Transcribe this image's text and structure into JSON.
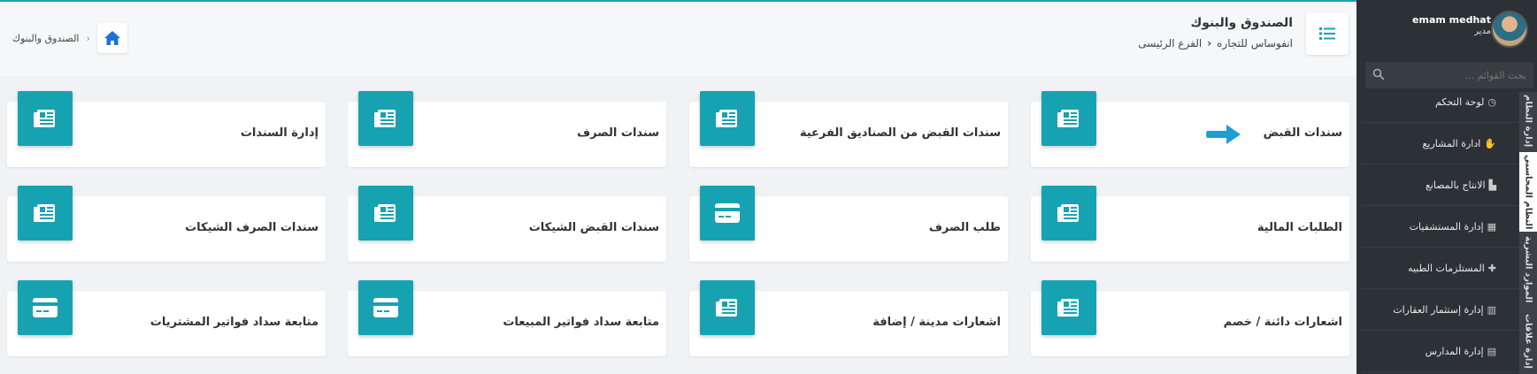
{
  "header": {
    "title": "الصندوق والبنوك",
    "company": "انفوساس للتجاره",
    "branch": "الفرع الرئيسى",
    "breadcrumb": "الصندوق والبنوك"
  },
  "cards": [
    {
      "label": "سندات القبض",
      "icon": "receipt-icon"
    },
    {
      "label": "سندات القبض من الصناديق الفرعية",
      "icon": "receipt-icon"
    },
    {
      "label": "سندات الصرف",
      "icon": "receipt-icon"
    },
    {
      "label": "إدارة السندات",
      "icon": "receipt-icon"
    },
    {
      "label": "الطلبات المالية",
      "icon": "receipt-icon"
    },
    {
      "label": "طلب الصرف",
      "icon": "credit-card-icon"
    },
    {
      "label": "سندات القبض الشيكات",
      "icon": "receipt-icon"
    },
    {
      "label": "سندات الصرف الشيكات",
      "icon": "receipt-icon"
    },
    {
      "label": "اشعارات دائنة / خصم",
      "icon": "receipt-icon"
    },
    {
      "label": "اشعارات مدينة / إضافة",
      "icon": "receipt-icon"
    },
    {
      "label": "متابعة سداد فواتير المبيعات",
      "icon": "credit-card-icon"
    },
    {
      "label": "متابعة سداد فواتير المشتريات",
      "icon": "credit-card-icon"
    }
  ],
  "sidebar": {
    "user_name": "emam medhat",
    "user_role": "مدير",
    "search_placeholder": "بحث القوائم ...",
    "tabs": [
      "إدارة النظام",
      "النظام المحاسبي",
      "الموارد البشرية",
      "إدارة علاقات"
    ],
    "items": [
      {
        "label": "لوحة التحكم",
        "icon": "dashboard-icon"
      },
      {
        "label": "ادارة المشاريع",
        "icon": "handshake-icon"
      },
      {
        "label": "الانتاج بالمصانع",
        "icon": "factory-icon"
      },
      {
        "label": "إدارة المستشفيات",
        "icon": "hospital-icon"
      },
      {
        "label": "المستلزمات الطبيه",
        "icon": "medkit-icon"
      },
      {
        "label": "إدارة إستثمار العقارات",
        "icon": "building-icon"
      },
      {
        "label": "إدارة المدارس",
        "icon": "school-icon"
      }
    ]
  },
  "colors": {
    "accent": "#17a2b2",
    "sidebar": "#2c3135",
    "arrow": "#1a9fd8"
  }
}
